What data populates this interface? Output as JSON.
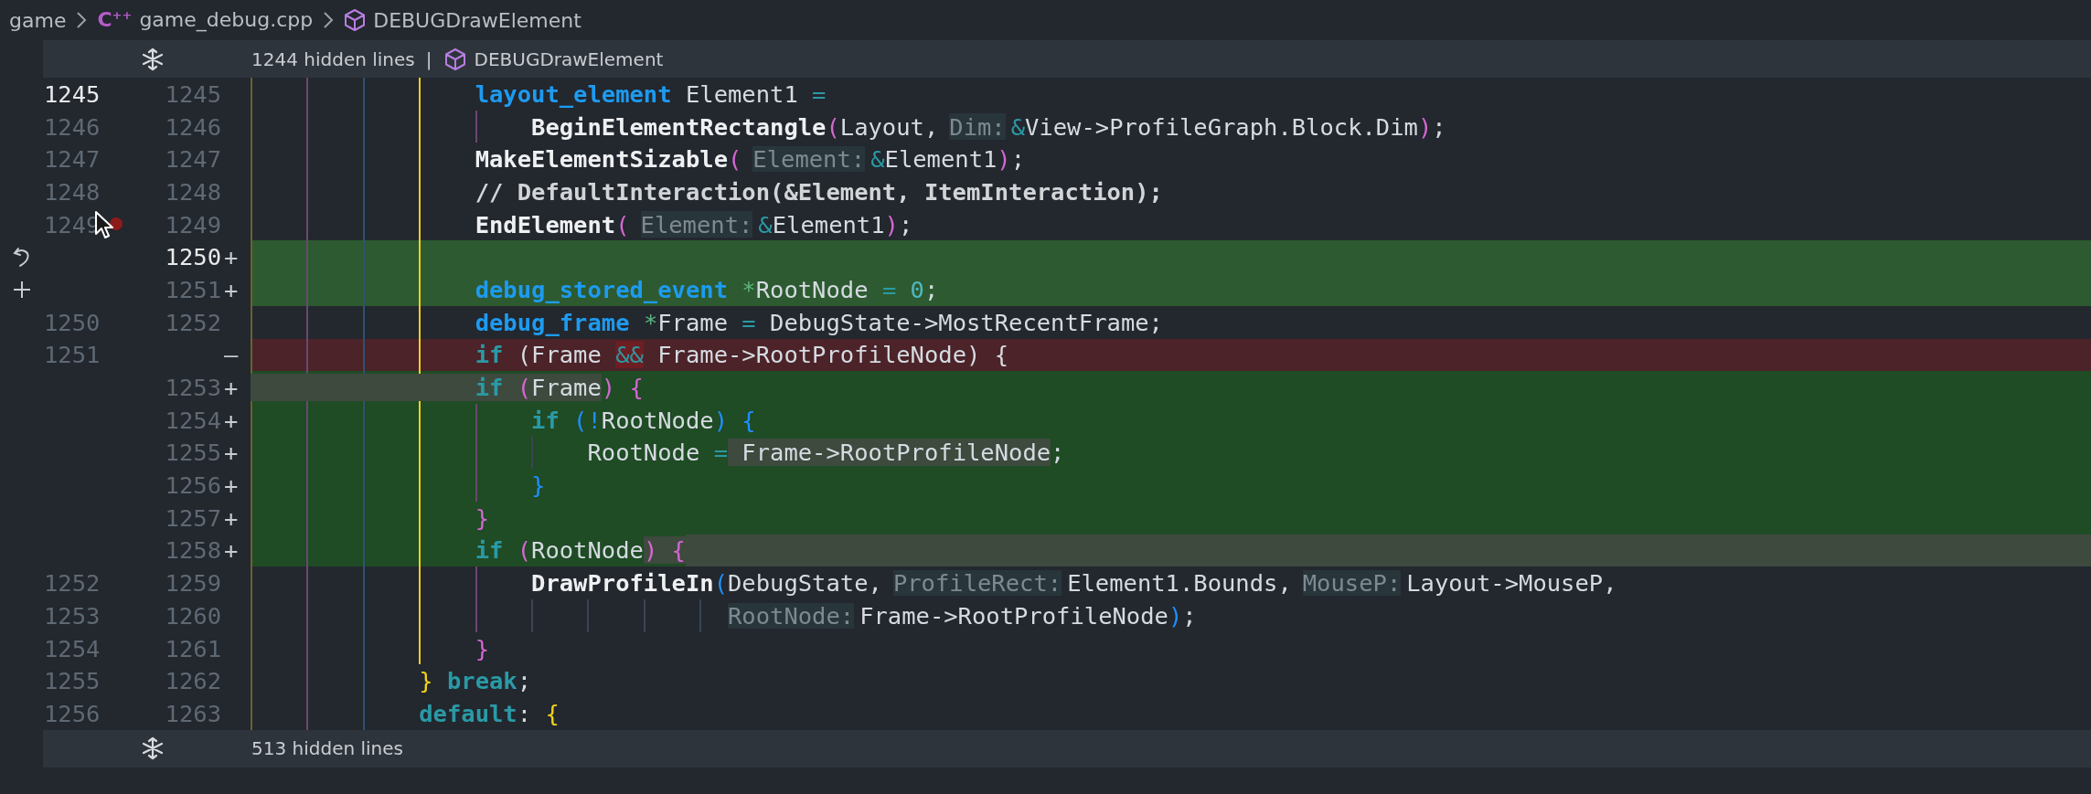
{
  "breadcrumb": [
    {
      "kind": "folder",
      "label": "game"
    },
    {
      "kind": "file",
      "icon_text": "C$^{++}$",
      "label": "game_debug.cpp"
    },
    {
      "kind": "symbol",
      "label": "DEBUGDrawElement"
    }
  ],
  "fold_top": {
    "label": "1244 hidden lines",
    "separator": "|",
    "symbol": "DEBUGDrawElement"
  },
  "lines": [
    {
      "kind": "context",
      "old": "1245",
      "new": "1245",
      "old_active": true,
      "new_active": false,
      "breakpoint": false,
      "whole": false,
      "tail": false,
      "tokens": [
        {
          "kind": "type",
          "text": "                layout_element",
          "changed": false
        },
        {
          "kind": "var",
          "text": " Element1 ",
          "changed": false
        },
        {
          "kind": "op",
          "text": "=",
          "changed": false
        }
      ]
    },
    {
      "kind": "context",
      "old": "1246",
      "new": "1246",
      "old_active": false,
      "new_active": false,
      "breakpoint": false,
      "whole": false,
      "tail": false,
      "tokens": [
        {
          "kind": "fn",
          "text": "                    BeginElementRectangle",
          "changed": false
        },
        {
          "kind": "p1",
          "text": "(",
          "changed": false
        },
        {
          "kind": "var",
          "text": "Layout,",
          "changed": false
        },
        {
          "kind": "hint",
          "text": "Dim:",
          "changed": false
        },
        {
          "kind": "op",
          "text": "&",
          "changed": false
        },
        {
          "kind": "var",
          "text": "View->ProfileGraph.Block.Dim",
          "changed": false
        },
        {
          "kind": "p1",
          "text": ")",
          "changed": false
        },
        {
          "kind": "var",
          "text": ";",
          "changed": false
        }
      ]
    },
    {
      "kind": "context",
      "old": "1247",
      "new": "1247",
      "old_active": false,
      "new_active": false,
      "breakpoint": false,
      "whole": false,
      "tail": false,
      "tokens": [
        {
          "kind": "fn",
          "text": "                MakeElementSizable",
          "changed": false
        },
        {
          "kind": "p1",
          "text": "(",
          "changed": false
        },
        {
          "kind": "hint",
          "text": "Element:",
          "changed": false
        },
        {
          "kind": "op",
          "text": "&",
          "changed": false
        },
        {
          "kind": "var",
          "text": "Element1",
          "changed": false
        },
        {
          "kind": "p1",
          "text": ")",
          "changed": false
        },
        {
          "kind": "var",
          "text": ";",
          "changed": false
        }
      ]
    },
    {
      "kind": "context",
      "old": "1248",
      "new": "1248",
      "old_active": false,
      "new_active": false,
      "breakpoint": false,
      "whole": false,
      "tail": false,
      "tokens": [
        {
          "kind": "cmt",
          "text": "                // DefaultInteraction(&Element, ItemInteraction);",
          "changed": false
        }
      ]
    },
    {
      "kind": "context",
      "old": "1249",
      "new": "1249",
      "old_active": false,
      "new_active": false,
      "breakpoint": true,
      "whole": false,
      "tail": false,
      "tokens": [
        {
          "kind": "fn",
          "text": "                EndElement",
          "changed": false
        },
        {
          "kind": "p1",
          "text": "(",
          "changed": false
        },
        {
          "kind": "hint",
          "text": "Element:",
          "changed": false
        },
        {
          "kind": "op",
          "text": "&",
          "changed": false
        },
        {
          "kind": "var",
          "text": "Element1",
          "changed": false
        },
        {
          "kind": "p1",
          "text": ")",
          "changed": false
        },
        {
          "kind": "var",
          "text": ";",
          "changed": false
        }
      ]
    },
    {
      "kind": "added",
      "new": "1250",
      "marker": "+",
      "new_active": true,
      "breakpoint": false,
      "whole": true,
      "tail": false
    },
    {
      "kind": "added",
      "new": "1251",
      "marker": "+",
      "new_active": false,
      "breakpoint": false,
      "whole": true,
      "tail": false,
      "tokens": [
        {
          "kind": "type",
          "text": "                debug_stored_event ",
          "changed": false
        },
        {
          "kind": "ptr",
          "text": "*",
          "changed": false
        },
        {
          "kind": "var",
          "text": "RootNode ",
          "changed": false
        },
        {
          "kind": "op",
          "text": "= ",
          "changed": false
        },
        {
          "kind": "num",
          "text": "0",
          "changed": false
        },
        {
          "kind": "var",
          "text": ";",
          "changed": false
        }
      ]
    },
    {
      "kind": "context",
      "old": "1250",
      "new": "1252",
      "old_active": false,
      "new_active": false,
      "breakpoint": false,
      "whole": false,
      "tail": false,
      "tokens": [
        {
          "kind": "type",
          "text": "                debug_frame ",
          "changed": false
        },
        {
          "kind": "ptr",
          "text": "*",
          "changed": false
        },
        {
          "kind": "var",
          "text": "Frame ",
          "changed": false
        },
        {
          "kind": "op",
          "text": "=",
          "changed": false
        },
        {
          "kind": "var",
          "text": " DebugState->MostRecentFrame;",
          "changed": false
        }
      ]
    },
    {
      "kind": "removed",
      "old": "1251",
      "marker": "—",
      "old_active": false,
      "breakpoint": false,
      "whole": false,
      "tail": false,
      "tokens": [
        {
          "kind": "kw",
          "text": "                if",
          "changed": false
        },
        {
          "kind": "var",
          "text": " (Frame ",
          "changed": false
        },
        {
          "kind": "op",
          "text": "&&",
          "changed": true
        },
        {
          "kind": "var",
          "text": " Frame->RootProfileNode) {",
          "changed": false
        }
      ]
    },
    {
      "kind": "added",
      "new": "1253",
      "marker": "+",
      "new_active": false,
      "breakpoint": false,
      "whole": false,
      "tail": false,
      "tokens": [
        {
          "kind": "kw",
          "text": "                if",
          "changed": true
        },
        {
          "kind": "p1",
          "text": " (",
          "changed": true
        },
        {
          "kind": "var",
          "text": "Frame",
          "changed": true
        },
        {
          "kind": "p1",
          "text": ") {",
          "changed": false
        }
      ]
    },
    {
      "kind": "added",
      "new": "1254",
      "marker": "+",
      "new_active": false,
      "breakpoint": false,
      "whole": false,
      "tail": false,
      "tokens": [
        {
          "kind": "kw",
          "text": "                    if",
          "changed": false
        },
        {
          "kind": "p2",
          "text": " (!",
          "changed": false
        },
        {
          "kind": "var",
          "text": "RootNode",
          "changed": false
        },
        {
          "kind": "p2",
          "text": ") {",
          "changed": false
        }
      ]
    },
    {
      "kind": "added",
      "new": "1255",
      "marker": "+",
      "new_active": false,
      "breakpoint": false,
      "whole": false,
      "tail": false,
      "tokens": [
        {
          "kind": "var",
          "text": "                        RootNode ",
          "changed": false
        },
        {
          "kind": "op",
          "text": "=",
          "changed": false
        },
        {
          "kind": "var",
          "text": " Frame->RootProfileNode",
          "changed": true
        },
        {
          "kind": "var",
          "text": ";",
          "changed": false
        }
      ]
    },
    {
      "kind": "added",
      "new": "1256",
      "marker": "+",
      "new_active": false,
      "breakpoint": false,
      "whole": false,
      "tail": false,
      "tokens": [
        {
          "kind": "p2",
          "text": "                    }",
          "changed": false
        }
      ]
    },
    {
      "kind": "added",
      "new": "1257",
      "marker": "+",
      "new_active": false,
      "breakpoint": false,
      "whole": false,
      "tail": false,
      "tokens": [
        {
          "kind": "p1",
          "text": "                }",
          "changed": false
        }
      ]
    },
    {
      "kind": "added",
      "new": "1258",
      "marker": "+",
      "new_active": false,
      "breakpoint": false,
      "whole": false,
      "tail": true,
      "tokens": [
        {
          "kind": "kw",
          "text": "                if",
          "changed": false
        },
        {
          "kind": "p1",
          "text": " (",
          "changed": false
        },
        {
          "kind": "var",
          "text": "RootNode",
          "changed": false
        },
        {
          "kind": "p1",
          "text": ") {",
          "changed": true
        }
      ]
    },
    {
      "kind": "context",
      "old": "1252",
      "new": "1259",
      "old_active": false,
      "new_active": false,
      "breakpoint": false,
      "whole": false,
      "tail": false,
      "tokens": [
        {
          "kind": "fn",
          "text": "                    DrawProfileIn",
          "changed": false
        },
        {
          "kind": "p2",
          "text": "(",
          "changed": false
        },
        {
          "kind": "var",
          "text": "DebugState,",
          "changed": false
        },
        {
          "kind": "hint",
          "text": "ProfileRect:",
          "changed": false
        },
        {
          "kind": "var",
          "text": "Element1.Bounds,",
          "changed": false
        },
        {
          "kind": "hint",
          "text": "MouseP:",
          "changed": false
        },
        {
          "kind": "var",
          "text": "Layout->MouseP,",
          "changed": false
        }
      ]
    },
    {
      "kind": "context",
      "old": "1253",
      "new": "1260",
      "old_active": false,
      "new_active": false,
      "breakpoint": false,
      "whole": false,
      "tail": false,
      "tokens": [
        {
          "kind": "hint",
          "text": "                                  RootNode:",
          "changed": false
        },
        {
          "kind": "var",
          "text": "Frame->RootProfileNode",
          "changed": false
        },
        {
          "kind": "p2",
          "text": ")",
          "changed": false
        },
        {
          "kind": "var",
          "text": ";",
          "changed": false
        }
      ]
    },
    {
      "kind": "context",
      "old": "1254",
      "new": "1261",
      "old_active": false,
      "new_active": false,
      "breakpoint": false,
      "whole": false,
      "tail": false,
      "tokens": [
        {
          "kind": "p1",
          "text": "                }",
          "changed": false
        }
      ]
    },
    {
      "kind": "context",
      "old": "1255",
      "new": "1262",
      "old_active": false,
      "new_active": false,
      "breakpoint": false,
      "whole": false,
      "tail": false,
      "tokens": [
        {
          "kind": "p3",
          "text": "            }",
          "changed": false
        },
        {
          "kind": "kw",
          "text": " break",
          "changed": false
        },
        {
          "kind": "var",
          "text": ";",
          "changed": false
        }
      ]
    },
    {
      "kind": "context",
      "old": "1256",
      "new": "1263",
      "old_active": false,
      "new_active": false,
      "breakpoint": false,
      "whole": false,
      "tail": false,
      "tokens": [
        {
          "kind": "kw",
          "text": "            default",
          "changed": false
        },
        {
          "kind": "var",
          "text": ": ",
          "changed": false
        },
        {
          "kind": "p3",
          "text": "{",
          "changed": false
        }
      ]
    }
  ],
  "fold_bottom": {
    "label": "513 hidden lines"
  }
}
